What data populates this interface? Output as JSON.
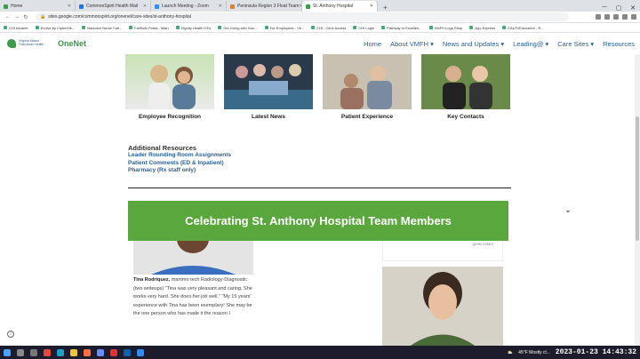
{
  "browser": {
    "tabs": [
      {
        "label": "Home",
        "color": "#3d9b4a"
      },
      {
        "label": "CommonSpirit Health Mail",
        "color": "#1a73e8"
      },
      {
        "label": "Launch Meeting - Zoom",
        "color": "#2d8cff"
      },
      {
        "label": "Peninsula Region 3 Float Team",
        "color": "#e67e22"
      },
      {
        "label": "St. Anthony Hospital",
        "color": "#3d9b4a"
      }
    ],
    "new_tab": "+",
    "url": "sites.google.com/commonspirit.org/onenet/care-sites/st-anthony-hospital",
    "bookmarks": [
      "CHI Intranet",
      "Evolve by CipherHe...",
      "Navicare Nurse Call...",
      "FallSafe Portal - Main",
      "Dignity Health CEs",
      "Get Going with Goo...",
      "For Employees - Vir...",
      "CHI - Citrix Access",
      "CHI Login",
      "Pathway to Excellen...",
      "VMFH Logo Shop",
      "Arjo Express",
      "CAUTI/Education - R..."
    ]
  },
  "site": {
    "logo_small": "Virginia Mason Franciscan Health",
    "logo_name": "OneNet",
    "nav": [
      "Home",
      "About VMFH ▾",
      "News and Updates ▾",
      "Leading@ ▾",
      "Care Sites ▾",
      "Resources"
    ]
  },
  "tiles": [
    {
      "label": "Employee Recognition"
    },
    {
      "label": "Latest News"
    },
    {
      "label": "Patient Experience"
    },
    {
      "label": "Key Contacts"
    }
  ],
  "additional": {
    "heading": "Additional Resources",
    "links": [
      "Leader Rounding Room Assignments",
      "Patient Comments (ED & Inpatient)",
      "Pharmacy (Rx staff only)"
    ]
  },
  "banner": "Celebrating St. Anthony Hospital Team Members",
  "card": {
    "name": "Tina Rodriquez,",
    "text": "mammo tech Radiology-Diagnostic (two writeups) \"Tina was very pleasant and caring. She works very hard. She does her job well.\" \"My 15 years' experience with Tina has been exemplary! She may be the one person who has made it the reason I"
  },
  "great_text": "great colors",
  "taskbar": {
    "weather": "45°F  Mostly cl...",
    "datetime": "2023-01-23  14:43:32"
  }
}
